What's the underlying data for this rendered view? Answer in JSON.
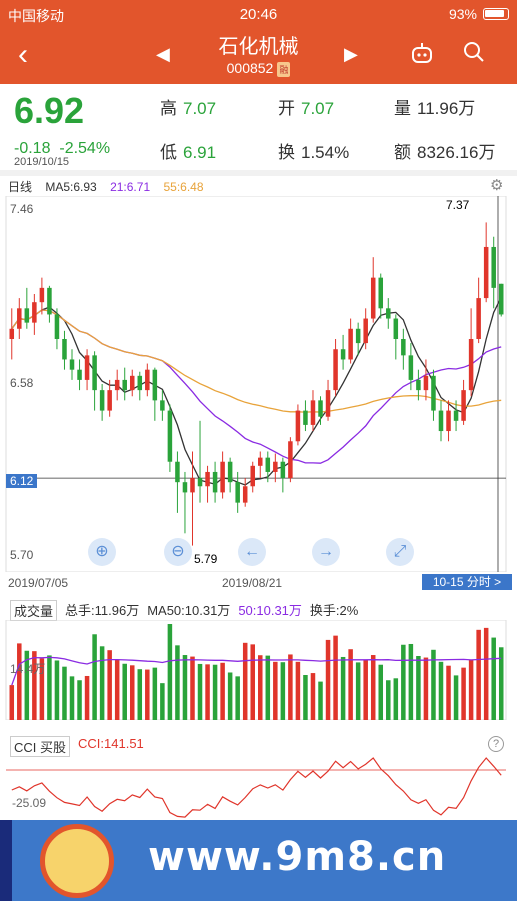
{
  "status": {
    "carrier": "中国移动",
    "time": "20:46",
    "battery": "93%"
  },
  "nav": {
    "title": "石化机械",
    "code": "000852",
    "badge": "融",
    "back": "‹",
    "prev": "◀",
    "next": "▶"
  },
  "quote": {
    "price": "6.92",
    "change": "-0.18",
    "change_pct": "-2.54%",
    "date": "2019/10/15",
    "high_label": "高",
    "high": "7.07",
    "open_label": "开",
    "open": "7.07",
    "vol_label": "量",
    "vol": "11.96万",
    "low_label": "低",
    "low": "6.91",
    "turn_label": "换",
    "turn": "1.54%",
    "amt_label": "额",
    "amt": "8326.16万"
  },
  "kline": {
    "period": "日线",
    "ma5": "MA5:6.93",
    "ma21": "21:6.71",
    "ma55": "55:6.48",
    "y_top": "7.46",
    "y_mid": "6.58",
    "y_cur": "6.12",
    "y_bot": "5.70",
    "hi_mark": "7.37",
    "lo_mark": "5.79",
    "date_left": "2019/07/05",
    "date_mid": "2019/08/21",
    "fenshi": "10-15 分时 >"
  },
  "volume": {
    "label": "成交量",
    "total": "总手:11.96万",
    "ma50": "MA50:10.31万",
    "v50": "50:10.31万",
    "turn": "换手:2%",
    "axis": "14.4万"
  },
  "cci": {
    "label": "CCI 买股",
    "value": "CCI:141.51",
    "axis": "-25.09"
  },
  "watermark": {
    "url": "www.9m8.cn"
  },
  "colors": {
    "brand": "#e2552c",
    "up": "#e0352b",
    "down": "#2aa33a",
    "ma5": "#333333",
    "ma21": "#8a2be2",
    "ma55": "#e8a33a",
    "accent": "#3b76c9"
  },
  "chart_data": {
    "type": "candlestick",
    "ylim": [
      5.7,
      7.46
    ],
    "candles": [
      [
        6.8,
        6.85,
        6.95,
        6.7
      ],
      [
        6.85,
        6.95,
        7.0,
        6.8
      ],
      [
        6.95,
        6.88,
        7.05,
        6.85
      ],
      [
        6.88,
        6.98,
        7.02,
        6.82
      ],
      [
        6.98,
        7.05,
        7.1,
        6.92
      ],
      [
        7.05,
        6.92,
        7.06,
        6.88
      ],
      [
        6.92,
        6.8,
        6.95,
        6.75
      ],
      [
        6.8,
        6.7,
        6.84,
        6.65
      ],
      [
        6.7,
        6.65,
        6.75,
        6.6
      ],
      [
        6.65,
        6.6,
        6.7,
        6.55
      ],
      [
        6.6,
        6.72,
        6.75,
        6.55
      ],
      [
        6.72,
        6.55,
        6.74,
        6.45
      ],
      [
        6.55,
        6.45,
        6.58,
        6.4
      ],
      [
        6.45,
        6.55,
        6.6,
        6.42
      ],
      [
        6.55,
        6.6,
        6.65,
        6.5
      ],
      [
        6.6,
        6.55,
        6.66,
        6.5
      ],
      [
        6.55,
        6.62,
        6.65,
        6.52
      ],
      [
        6.62,
        6.55,
        6.64,
        6.5
      ],
      [
        6.55,
        6.65,
        6.68,
        6.52
      ],
      [
        6.65,
        6.5,
        6.66,
        6.4
      ],
      [
        6.5,
        6.45,
        6.55,
        6.4
      ],
      [
        6.45,
        6.2,
        6.48,
        6.15
      ],
      [
        6.2,
        6.1,
        6.25,
        5.95
      ],
      [
        6.1,
        6.05,
        6.15,
        5.85
      ],
      [
        6.05,
        6.12,
        6.25,
        5.79
      ],
      [
        6.12,
        6.08,
        6.4,
        6.0
      ],
      [
        6.08,
        6.15,
        6.18,
        6.0
      ],
      [
        6.15,
        6.05,
        6.2,
        6.0
      ],
      [
        6.05,
        6.2,
        6.25,
        6.02
      ],
      [
        6.2,
        6.1,
        6.22,
        6.05
      ],
      [
        6.1,
        6.0,
        6.15,
        5.95
      ],
      [
        6.0,
        6.08,
        6.12,
        5.98
      ],
      [
        6.08,
        6.18,
        6.2,
        6.05
      ],
      [
        6.18,
        6.22,
        6.25,
        6.12
      ],
      [
        6.22,
        6.15,
        6.25,
        6.1
      ],
      [
        6.15,
        6.2,
        6.24,
        6.1
      ],
      [
        6.2,
        6.12,
        6.22,
        6.05
      ],
      [
        6.12,
        6.3,
        6.32,
        6.1
      ],
      [
        6.3,
        6.45,
        6.48,
        6.28
      ],
      [
        6.45,
        6.38,
        6.5,
        6.35
      ],
      [
        6.38,
        6.5,
        6.55,
        6.35
      ],
      [
        6.5,
        6.42,
        6.52,
        6.38
      ],
      [
        6.42,
        6.55,
        6.6,
        6.4
      ],
      [
        6.55,
        6.75,
        6.8,
        6.52
      ],
      [
        6.75,
        6.7,
        6.82,
        6.65
      ],
      [
        6.7,
        6.85,
        6.9,
        6.68
      ],
      [
        6.85,
        6.78,
        6.88,
        6.72
      ],
      [
        6.78,
        6.9,
        6.95,
        6.75
      ],
      [
        6.9,
        7.1,
        7.2,
        6.88
      ],
      [
        7.1,
        6.95,
        7.12,
        6.9
      ],
      [
        6.95,
        6.9,
        7.0,
        6.85
      ],
      [
        6.9,
        6.8,
        6.92,
        6.7
      ],
      [
        6.8,
        6.72,
        6.85,
        6.65
      ],
      [
        6.72,
        6.6,
        6.78,
        6.55
      ],
      [
        6.6,
        6.55,
        6.65,
        6.5
      ],
      [
        6.55,
        6.62,
        6.7,
        6.5
      ],
      [
        6.62,
        6.45,
        6.65,
        6.4
      ],
      [
        6.45,
        6.35,
        6.5,
        6.3
      ],
      [
        6.35,
        6.45,
        6.5,
        6.3
      ],
      [
        6.45,
        6.4,
        6.5,
        6.35
      ],
      [
        6.4,
        6.55,
        6.6,
        6.38
      ],
      [
        6.55,
        6.8,
        6.95,
        6.52
      ],
      [
        6.8,
        7.0,
        7.1,
        6.78
      ],
      [
        7.0,
        7.25,
        7.37,
        6.98
      ],
      [
        7.25,
        7.05,
        7.3,
        6.95
      ],
      [
        7.07,
        6.92,
        7.07,
        6.91
      ]
    ]
  }
}
